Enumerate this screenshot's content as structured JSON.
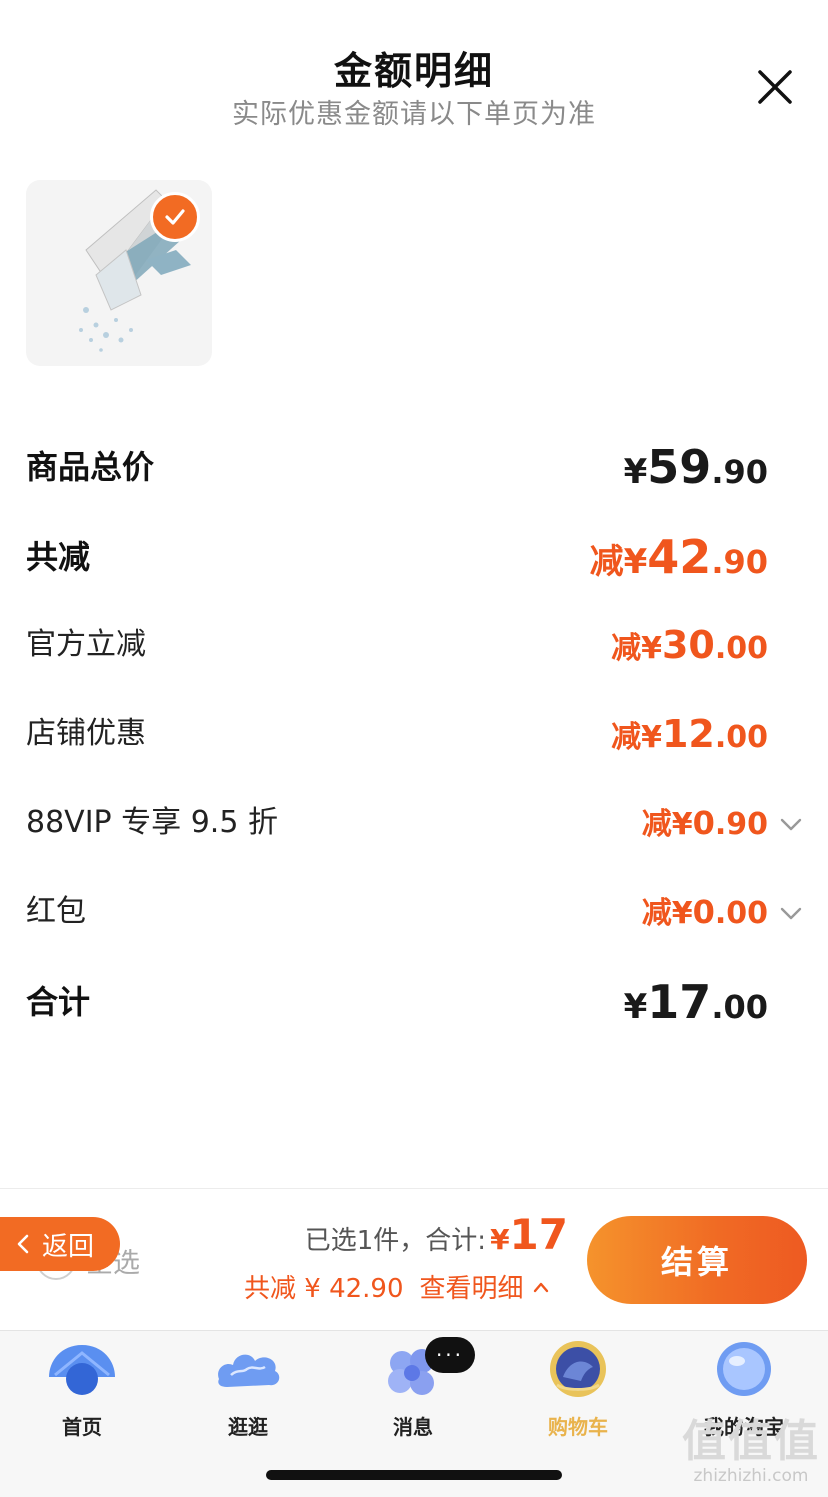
{
  "header": {
    "title": "金额明细",
    "subtitle": "实际优惠金额请以下单页为准",
    "close_icon": "close-icon"
  },
  "product": {
    "selected": true,
    "check_icon": "check-icon"
  },
  "rows": [
    {
      "label": "商品总价",
      "prefix": "",
      "currency": "¥",
      "int": "59",
      "dec": ".90",
      "style": "black",
      "has_chevron": false
    },
    {
      "label": "共减",
      "prefix": "减",
      "currency": "¥",
      "int": "42",
      "dec": ".90",
      "style": "orange",
      "has_chevron": false
    },
    {
      "label": "官方立减",
      "prefix": "减",
      "currency": "¥",
      "int": "30",
      "dec": ".00",
      "style": "orange",
      "has_chevron": false
    },
    {
      "label": "店铺优惠",
      "prefix": "减",
      "currency": "¥",
      "int": "12",
      "dec": ".00",
      "style": "orange",
      "has_chevron": false
    },
    {
      "label": "88VIP 专享 9.5 折",
      "prefix": "减",
      "currency": "¥",
      "int": "0",
      "dec": ".90",
      "style": "orange",
      "has_chevron": true
    },
    {
      "label": "红包",
      "prefix": "减",
      "currency": "¥",
      "int": "0",
      "dec": ".00",
      "style": "orange",
      "has_chevron": true
    },
    {
      "label": "合计",
      "prefix": "",
      "currency": "¥",
      "int": "17",
      "dec": ".00",
      "style": "black",
      "has_chevron": false
    }
  ],
  "bottom_bar": {
    "back_label": "返回",
    "select_all_label": "全选",
    "selected_text": "已选1件，合计:",
    "total_currency": "¥",
    "total_value": "17",
    "discount_text": "共减 ¥ 42.90",
    "view_detail_label": "查看明细",
    "checkout_label": "结算"
  },
  "tabbar": {
    "tabs": [
      {
        "label": "首页",
        "icon": "home-icon",
        "active": false
      },
      {
        "label": "逛逛",
        "icon": "browse-icon",
        "active": false
      },
      {
        "label": "消息",
        "icon": "message-icon",
        "active": false
      },
      {
        "label": "购物车",
        "icon": "cart-icon",
        "active": true
      },
      {
        "label": "我的淘宝",
        "icon": "profile-icon",
        "active": false
      }
    ],
    "message_badge": "···"
  },
  "watermark": {
    "main": "值值值",
    "url": "zhizhizhi.com"
  },
  "colors": {
    "accent": "#f0561d",
    "checkout_start": "#f5932c",
    "checkout_end": "#ee5a22",
    "active_tab": "#e9b34c"
  }
}
